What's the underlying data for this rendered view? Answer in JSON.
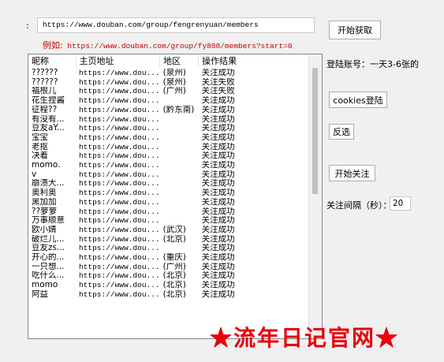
{
  "top": {
    "url_label": ":",
    "url_value": "https://www.douban.com/group/fengrenyuan/members",
    "example_label": "例如:",
    "example_text": "https://www.douban.com/group/fy888/members?start=0",
    "fetch_button": "开始获取"
  },
  "table": {
    "columns": [
      "昵称",
      "主页地址",
      "地区",
      "操作结果"
    ],
    "rows": [
      [
        "??????",
        "https://www.dou...",
        "(泉州)",
        "关注成功"
      ],
      [
        "??????",
        "https://www.dou...",
        "(泉州)",
        "关注失败"
      ],
      [
        "福根儿",
        "https://www.dou...",
        "(广州)",
        "关注失败"
      ],
      [
        "花生捏酱",
        "https://www.dou...",
        "",
        "关注成功"
      ],
      [
        "征程??",
        "https://www.dou...",
        "(黔东南)",
        "关注成功"
      ],
      [
        "有没有...",
        "https://www.dou...",
        "",
        "关注成功"
      ],
      [
        "豆友aY...",
        "https://www.dou...",
        "",
        "关注成功"
      ],
      [
        "宝宝",
        "https://www.dou...",
        "",
        "关注成功"
      ],
      [
        "老抠",
        "https://www.dou...",
        "",
        "关注成功"
      ],
      [
        "决着",
        "https://www.dou...",
        "",
        "关注成功"
      ],
      [
        "momo.",
        "https://www.dou...",
        "",
        "关注成功"
      ],
      [
        "v",
        "https://www.dou...",
        "",
        "关注成功"
      ],
      [
        "崩溃大...",
        "https://www.dou...",
        "",
        "关注成功"
      ],
      [
        "奥利奥",
        "https://www.dou...",
        "",
        "关注成功"
      ],
      [
        "黑加加",
        "https://www.dou...",
        "",
        "关注成功"
      ],
      [
        "??萝萝",
        "https://www.dou...",
        "",
        "关注成功"
      ],
      [
        "万事顺意",
        "https://www.dou...",
        "",
        "关注成功"
      ],
      [
        "欧小婧",
        "https://www.dou...",
        "(武汉)",
        "关注成功"
      ],
      [
        "破烂儿...",
        "https://www.dou...",
        "(北京)",
        "关注成功"
      ],
      [
        "豆友zs...",
        "https://www.dou...",
        "",
        "关注成功"
      ],
      [
        "开心的...",
        "https://www.dou...",
        "(重庆)",
        "关注成功"
      ],
      [
        "一只想...",
        "https://www.dou...",
        "(广州)",
        "关注成功"
      ],
      [
        "吃什么...",
        "https://www.dou...",
        "(北京)",
        "关注成功"
      ],
      [
        "momo",
        "https://www.dou...",
        "(北京)",
        "关注成功"
      ],
      [
        "阿益",
        "https://www.dou...",
        "(北京)",
        "关注成功"
      ]
    ]
  },
  "side": {
    "account_label": "登陆账号：一天3-6张的",
    "cookies_button": "cookies登陆",
    "invert_button": "反选",
    "follow_button": "开始关注",
    "interval_label": "关注间隔（秒）：",
    "interval_value": "20"
  },
  "watermark": "★流年日记官网★",
  "colors": {
    "example": "#c00000",
    "watermark": "#e8000b"
  }
}
